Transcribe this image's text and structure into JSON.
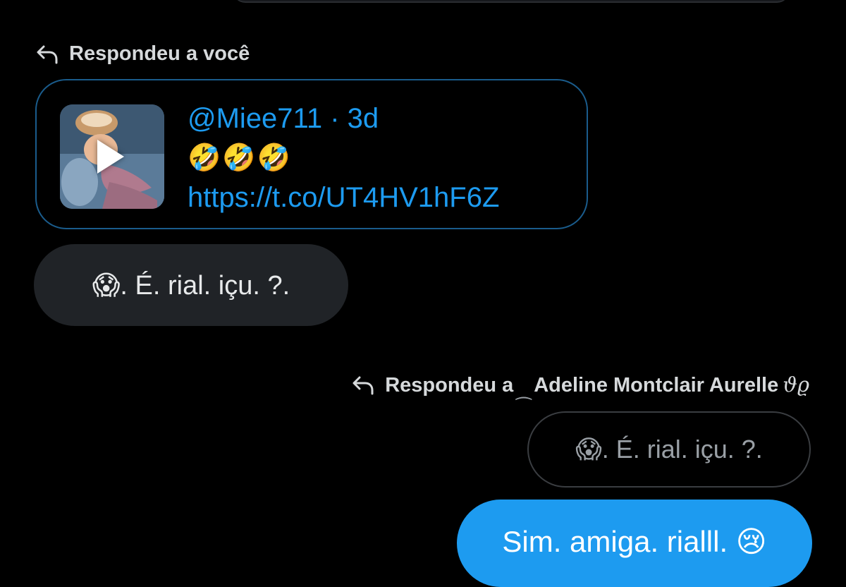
{
  "thread": {
    "first_reply": {
      "label": "Respondeu a você",
      "icon": "reply-arrow-icon"
    },
    "quoted_post": {
      "handle_time": "@Miee711 · 3d",
      "emojis": "🤣🤣🤣",
      "link": "https://t.co/UT4HV1hF6Z",
      "thumbnail": "video-thumbnail",
      "play_icon": "play-icon"
    },
    "received_message": {
      "text": "😱. É.  rial.  içu.  ?."
    },
    "second_reply": {
      "label_prefix": "Respondeu a",
      "decor": "⁔",
      "name": "Adeline Montclair Aurelle",
      "name_suffix": "ϑϱ",
      "icon": "reply-arrow-icon"
    },
    "quoted_message": {
      "text": "😱. É.  rial.  içu.  ?."
    },
    "sent_message": {
      "text": "Sim. amiga. rialll. 😢"
    }
  },
  "colors": {
    "background": "#000000",
    "accent": "#1d9bf0",
    "received_bubble": "#202327",
    "card_border": "#1a5c8c"
  }
}
